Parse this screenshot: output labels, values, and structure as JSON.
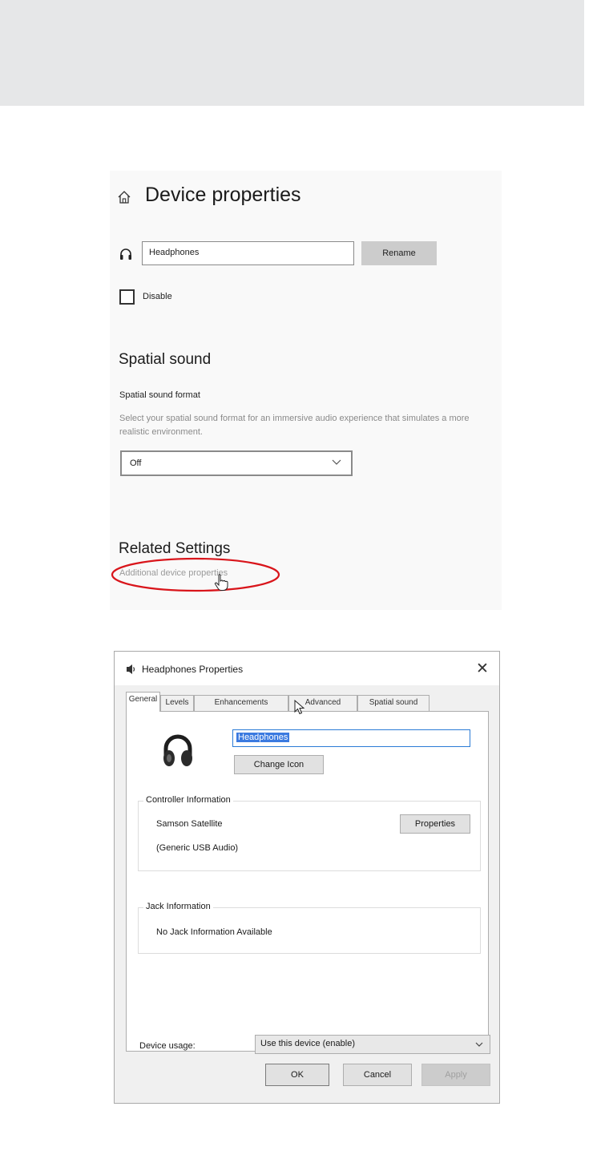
{
  "settings": {
    "title": "Device properties",
    "device_name": "Headphones",
    "rename_label": "Rename",
    "disable_label": "Disable",
    "spatial_heading": "Spatial sound",
    "spatial_format_label": "Spatial sound format",
    "spatial_description": "Select your spatial sound format for an immersive audio experience that simulates a more realistic environment.",
    "spatial_value": "Off",
    "related_heading": "Related Settings",
    "additional_link": "Additional device properties"
  },
  "dialog": {
    "title": "Headphones Properties",
    "close": "✕",
    "tabs": [
      "General",
      "Levels",
      "Enhancements",
      "Advanced",
      "Spatial sound"
    ],
    "active_tab": "General",
    "device_name": "Headphones",
    "change_icon_label": "Change Icon",
    "controller_group": "Controller Information",
    "controller_name": "Samson Satellite",
    "controller_sub": "(Generic USB Audio)",
    "properties_label": "Properties",
    "jack_group": "Jack Information",
    "jack_text": "No Jack Information Available",
    "usage_label": "Device usage:",
    "usage_value": "Use this device (enable)",
    "ok_label": "OK",
    "cancel_label": "Cancel",
    "apply_label": "Apply"
  },
  "annotation_color": "#d9151b"
}
